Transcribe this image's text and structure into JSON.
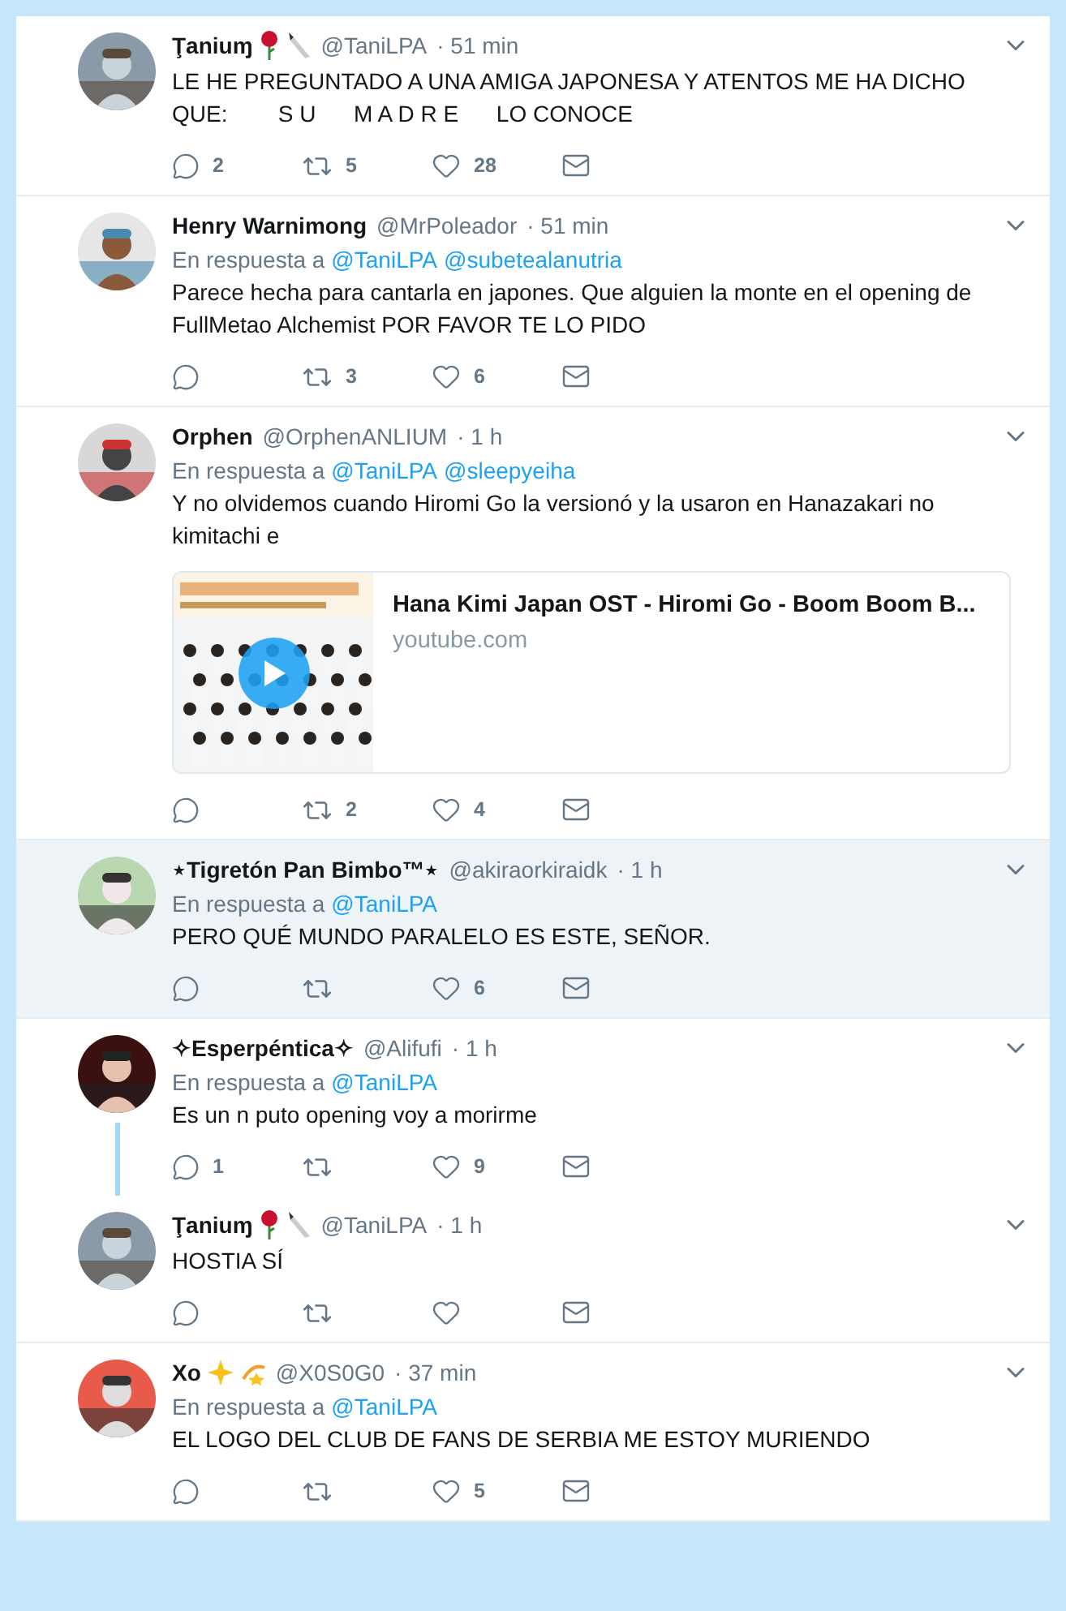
{
  "tweets": [
    {
      "name": "Ţaniuɱ",
      "name_icons": [
        {
          "kind": "rose"
        },
        {
          "kind": "knife"
        }
      ],
      "handle": "@TaniLPA",
      "time": "· 51 min",
      "text": "LE HE PREGUNTADO A UNA AMIGA JAPONESA Y ATENTOS ME HA DICHO QUE:        S U      M A D R E      LO CONOCE",
      "counts": {
        "reply": "2",
        "retweet": "5",
        "like": "28"
      },
      "highlighted": false,
      "threaded": false
    },
    {
      "name": "Henry Warnimong",
      "handle": "@MrPoleador",
      "time": "· 51 min",
      "reply_prefix": "En respuesta a",
      "mentions": [
        "@TaniLPA",
        "@subetealanutria"
      ],
      "text": "Parece hecha para cantarla en japones. Que alguien la monte en el opening de FullMetao Alchemist POR FAVOR TE LO PIDO",
      "counts": {
        "retweet": "3",
        "like": "6"
      },
      "highlighted": false,
      "threaded": false
    },
    {
      "name": "Orphen",
      "handle": "@OrphenANLIUM",
      "time": "· 1 h",
      "reply_prefix": "En respuesta a",
      "mentions": [
        "@TaniLPA",
        "@sleepyeiha"
      ],
      "text": "Y no olvidemos cuando Hiromi Go la versionó y la usaron en Hanazakari no kimitachi e",
      "card": {
        "title": "Hana Kimi Japan OST - Hiromi Go - Boom Boom B...",
        "domain": "youtube.com"
      },
      "counts": {
        "retweet": "2",
        "like": "4"
      },
      "highlighted": false,
      "threaded": false
    },
    {
      "name": "⋆Tigretón Pan Bimbo™⋆",
      "handle": "@akiraorkiraidk",
      "time": "· 1 h",
      "reply_prefix": "En respuesta a",
      "mentions": [
        "@TaniLPA"
      ],
      "text": "PERO QUÉ MUNDO PARALELO ES ESTE, SEÑOR.",
      "counts": {
        "like": "6"
      },
      "highlighted": true,
      "threaded": false
    },
    {
      "name": "✧Esperpéntica✧",
      "handle": "@Alifufi",
      "time": "· 1 h",
      "reply_prefix": "En respuesta a",
      "mentions": [
        "@TaniLPA"
      ],
      "text": "Es un n puto opening voy a morirme",
      "counts": {
        "reply": "1",
        "like": "9"
      },
      "highlighted": false,
      "threaded": true
    },
    {
      "name": "Ţaniuɱ",
      "name_icons": [
        {
          "kind": "rose"
        },
        {
          "kind": "knife"
        }
      ],
      "handle": "@TaniLPA",
      "time": "· 1 h",
      "text": "HOSTIA SÍ",
      "highlighted": false,
      "threaded": false
    },
    {
      "name": "Xo",
      "name_icons": [
        {
          "kind": "sparkles"
        },
        {
          "kind": "dizzy"
        }
      ],
      "handle": "@X0S0G0",
      "time": "· 37 min",
      "reply_prefix": "En respuesta a",
      "mentions": [
        "@TaniLPA"
      ],
      "text": "EL LOGO DEL CLUB DE FANS DE SERBIA ME ESTOY MURIENDO",
      "counts": {
        "like": "5"
      },
      "highlighted": false,
      "threaded": false
    }
  ]
}
